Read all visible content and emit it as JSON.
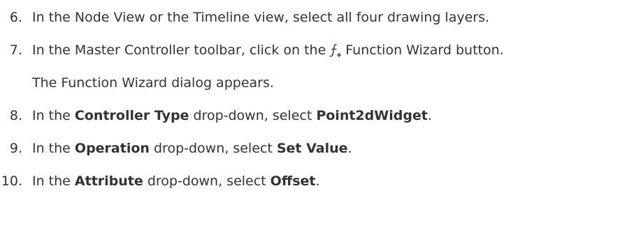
{
  "steps": [
    {
      "number": "6.",
      "text": "In the Node View or the Timeline view, select all four drawing layers."
    },
    {
      "number": "7.",
      "text_before": "In the Master Controller toolbar, click on the",
      "icon": "function-wizard-icon",
      "text_after": "Function Wizard button."
    },
    {
      "note": "The Function Wizard dialog appears."
    },
    {
      "number": "8.",
      "text_before": "In the",
      "bold_1": "Controller Type",
      "text_middle": "drop-down, select",
      "bold_2": "Point2dWidget",
      "text_after": "."
    },
    {
      "number": "9.",
      "text_before": "In the",
      "bold_1": "Operation",
      "text_middle": "drop-down, select",
      "bold_2": "Set Value",
      "text_after": "."
    },
    {
      "number": "10.",
      "text_before": "In the",
      "bold_1": "Attribute",
      "text_middle": "drop-down, select",
      "bold_2": "Offset",
      "text_after": "."
    }
  ],
  "colors": {
    "text": "#333333",
    "background": "#ffffff"
  }
}
